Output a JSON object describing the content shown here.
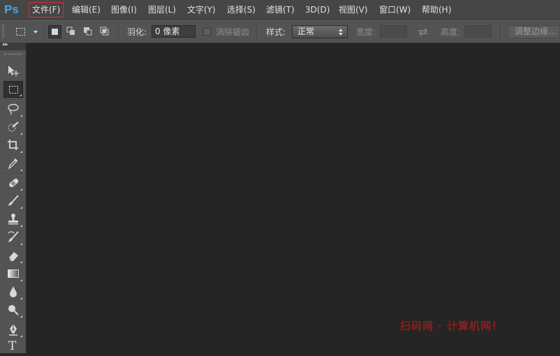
{
  "app": {
    "logo_text": "Ps"
  },
  "menu": [
    {
      "label": "文件(F)",
      "active": true
    },
    {
      "label": "编辑(E)"
    },
    {
      "label": "图像(I)"
    },
    {
      "label": "图层(L)"
    },
    {
      "label": "文字(Y)"
    },
    {
      "label": "选择(S)"
    },
    {
      "label": "滤镜(T)"
    },
    {
      "label": "3D(D)"
    },
    {
      "label": "视图(V)"
    },
    {
      "label": "窗口(W)"
    },
    {
      "label": "帮助(H)"
    }
  ],
  "options": {
    "feather_label": "羽化:",
    "feather_value": "0 像素",
    "antialias_label": "消除锯齿",
    "style_label": "样式:",
    "style_value": "正常",
    "width_label": "宽度:",
    "height_label": "高度:",
    "refine_edge_label": "调整边缘..."
  },
  "tools": [
    {
      "name": "move-tool"
    },
    {
      "name": "rectangular-marquee-tool",
      "selected": true
    },
    {
      "name": "lasso-tool"
    },
    {
      "name": "quick-selection-tool"
    },
    {
      "name": "crop-tool"
    },
    {
      "name": "eyedropper-tool"
    },
    {
      "name": "spot-healing-brush-tool"
    },
    {
      "name": "brush-tool"
    },
    {
      "name": "clone-stamp-tool"
    },
    {
      "name": "history-brush-tool"
    },
    {
      "name": "eraser-tool"
    },
    {
      "name": "gradient-tool"
    },
    {
      "name": "blur-tool"
    },
    {
      "name": "dodge-tool"
    },
    {
      "name": "pen-tool"
    },
    {
      "name": "type-tool",
      "glyph": "T"
    }
  ],
  "watermark": {
    "text": "扫码网 · 计算机网！"
  },
  "colors": {
    "accent_logo": "#4aa3e8",
    "active_menu_border": "#d43030",
    "watermark": "#8f1d1d"
  }
}
